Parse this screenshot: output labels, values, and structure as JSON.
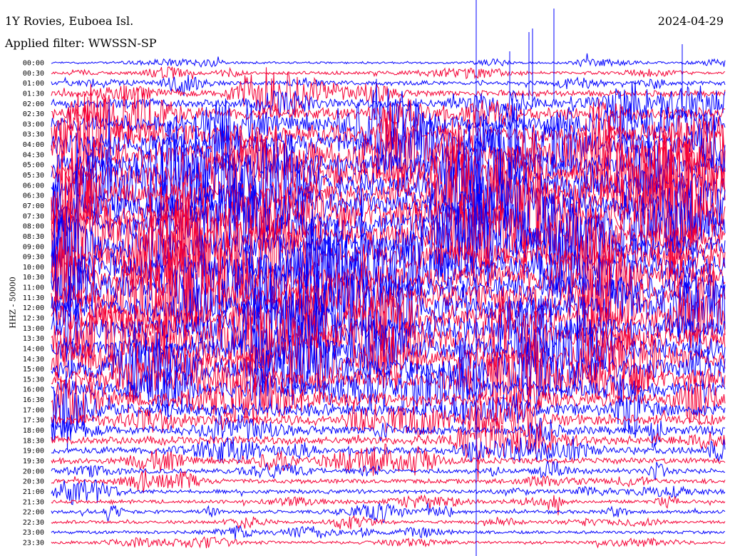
{
  "header": {
    "station": "1Y Rovies, Euboea Isl.",
    "filter": "Applied filter: WWSSN-SP",
    "date": "2024-04-29"
  },
  "chart_data": {
    "type": "line",
    "title": "1Y Rovies, Euboea Isl.",
    "subtitle": "Applied filter: WWSSN-SP",
    "ylabel": "HHZ - 50000",
    "xlabel": "",
    "grid": false,
    "colors": [
      "#0000ff",
      "#f50035"
    ],
    "row_labels": [
      "00:00",
      "00:30",
      "01:00",
      "01:30",
      "02:00",
      "02:30",
      "03:00",
      "03:30",
      "04:00",
      "04:30",
      "05:00",
      "05:30",
      "06:00",
      "06:30",
      "07:00",
      "07:30",
      "08:00",
      "08:30",
      "09:00",
      "09:30",
      "10:00",
      "10:30",
      "11:00",
      "11:30",
      "12:00",
      "12:30",
      "13:00",
      "13:30",
      "14:00",
      "14:30",
      "15:00",
      "15:30",
      "16:00",
      "16:30",
      "17:00",
      "17:30",
      "18:00",
      "18:30",
      "19:00",
      "19:30",
      "20:00",
      "20:30",
      "21:00",
      "21:30",
      "22:00",
      "22:30",
      "23:00",
      "23:30"
    ],
    "relative_amplitude": [
      0.25,
      0.35,
      0.5,
      0.7,
      1.0,
      1.3,
      1.8,
      2.2,
      2.5,
      2.7,
      2.8,
      2.9,
      3.0,
      3.0,
      3.0,
      3.0,
      3.0,
      3.0,
      3.0,
      3.0,
      3.0,
      3.0,
      2.9,
      2.9,
      2.8,
      2.8,
      2.7,
      2.6,
      2.5,
      2.4,
      2.2,
      2.0,
      1.8,
      1.6,
      1.4,
      1.2,
      1.0,
      0.9,
      0.8,
      0.65,
      0.55,
      0.5,
      0.45,
      0.4,
      0.38,
      0.36,
      0.35,
      0.35
    ]
  }
}
